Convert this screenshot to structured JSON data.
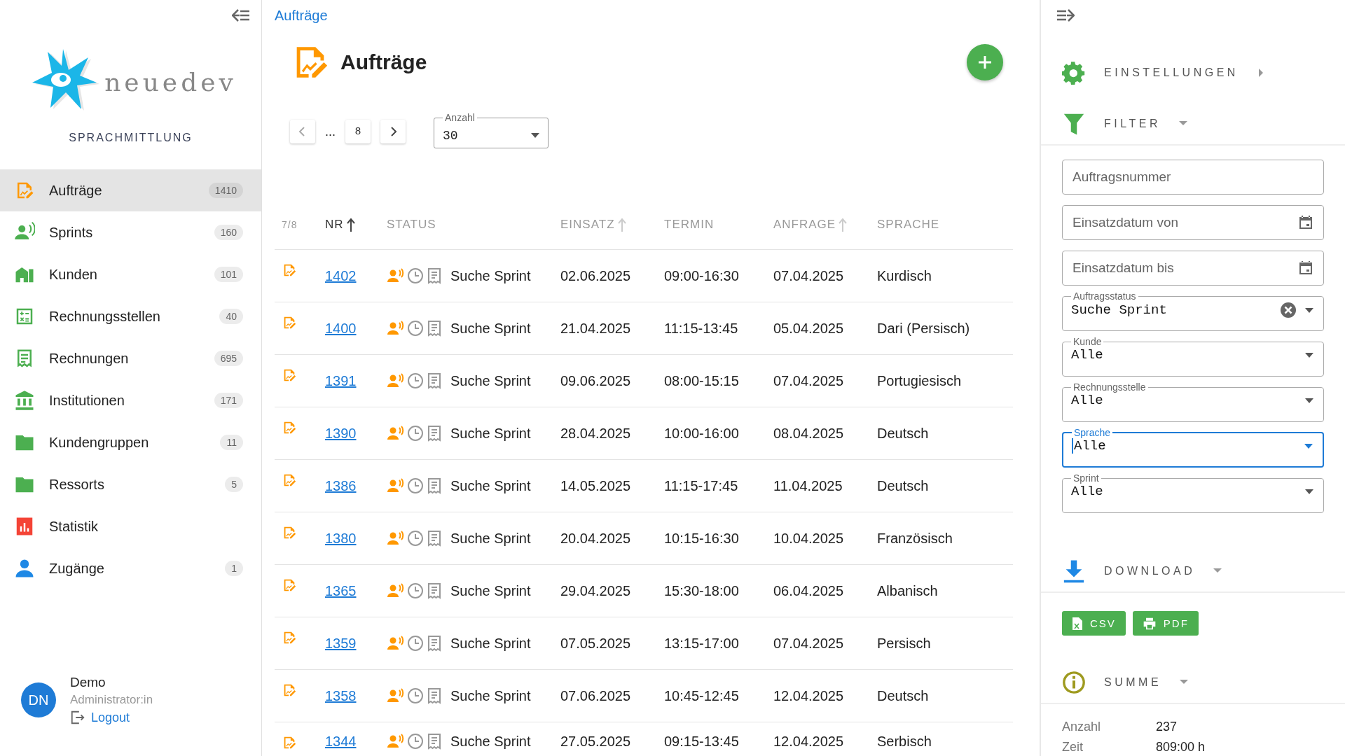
{
  "sidebar": {
    "brand": "neuedev",
    "subtitle": "SPRACHMITTLUNG",
    "items": [
      {
        "kind": "orders",
        "label": "Aufträge",
        "count": "1410",
        "color": "#ff9800",
        "selected": true
      },
      {
        "kind": "sprints",
        "label": "Sprints",
        "count": "160",
        "color": "#4caf50",
        "selected": false
      },
      {
        "kind": "customers",
        "label": "Kunden",
        "count": "101",
        "color": "#4caf50",
        "selected": false
      },
      {
        "kind": "billing",
        "label": "Rechnungsstellen",
        "count": "40",
        "color": "#4caf50",
        "selected": false
      },
      {
        "kind": "invoices",
        "label": "Rechnungen",
        "count": "695",
        "color": "#4caf50",
        "selected": false
      },
      {
        "kind": "institutions",
        "label": "Institutionen",
        "count": "171",
        "color": "#4caf50",
        "selected": false
      },
      {
        "kind": "groups",
        "label": "Kundengruppen",
        "count": "11",
        "color": "#4caf50",
        "selected": false
      },
      {
        "kind": "groups",
        "label": "Ressorts",
        "count": "5",
        "color": "#4caf50",
        "selected": false
      },
      {
        "kind": "stats",
        "label": "Statistik",
        "color": "#f44336",
        "selected": false
      },
      {
        "kind": "user",
        "label": "Zugänge",
        "count": "1",
        "color": "#1e88e5",
        "selected": false
      }
    ],
    "user": {
      "initials": "DN",
      "name": "Demo",
      "role": "Administrator:in",
      "logout": "Logout"
    }
  },
  "main": {
    "breadcrumb": "Aufträge",
    "title": "Aufträge",
    "pagination": {
      "ellipsis": "...",
      "page": "8"
    },
    "page_size": {
      "label": "Anzahl",
      "value": "30"
    },
    "table": {
      "columns": [
        {
          "label": "7/8"
        },
        {
          "label": "NR",
          "sorted": true
        },
        {
          "label": "STATUS"
        },
        {
          "label": "EINSATZ",
          "sorted": false
        },
        {
          "label": "TERMIN"
        },
        {
          "label": "ANFRAGE",
          "sorted": false
        },
        {
          "label": "SPRACHE"
        }
      ],
      "rows": [
        {
          "nr": "1402",
          "status": "Suche Sprint",
          "einsatz": "02.06.2025",
          "termin": "09:00-16:30",
          "anfrage": "07.04.2025",
          "sprache": "Kurdisch"
        },
        {
          "nr": "1400",
          "status": "Suche Sprint",
          "einsatz": "21.04.2025",
          "termin": "11:15-13:45",
          "anfrage": "05.04.2025",
          "sprache": "Dari (Persisch)"
        },
        {
          "nr": "1391",
          "status": "Suche Sprint",
          "einsatz": "09.06.2025",
          "termin": "08:00-15:15",
          "anfrage": "07.04.2025",
          "sprache": "Portugiesisch"
        },
        {
          "nr": "1390",
          "status": "Suche Sprint",
          "einsatz": "28.04.2025",
          "termin": "10:00-16:00",
          "anfrage": "08.04.2025",
          "sprache": "Deutsch"
        },
        {
          "nr": "1386",
          "status": "Suche Sprint",
          "einsatz": "14.05.2025",
          "termin": "11:15-17:45",
          "anfrage": "11.04.2025",
          "sprache": "Deutsch"
        },
        {
          "nr": "1380",
          "status": "Suche Sprint",
          "einsatz": "20.04.2025",
          "termin": "10:15-16:30",
          "anfrage": "10.04.2025",
          "sprache": "Französisch"
        },
        {
          "nr": "1365",
          "status": "Suche Sprint",
          "einsatz": "29.04.2025",
          "termin": "15:30-18:00",
          "anfrage": "06.04.2025",
          "sprache": "Albanisch"
        },
        {
          "nr": "1359",
          "status": "Suche Sprint",
          "einsatz": "07.05.2025",
          "termin": "13:15-17:00",
          "anfrage": "07.04.2025",
          "sprache": "Persisch"
        },
        {
          "nr": "1358",
          "status": "Suche Sprint",
          "einsatz": "07.06.2025",
          "termin": "10:45-12:45",
          "anfrage": "12.04.2025",
          "sprache": "Deutsch"
        },
        {
          "nr": "1344",
          "status": "Suche Sprint",
          "einsatz": "27.05.2025",
          "termin": "09:15-13:45",
          "anfrage": "12.04.2025",
          "sprache": "Serbisch"
        }
      ]
    }
  },
  "panel": {
    "sections": [
      {
        "kind": "settings",
        "title": "EINSTELLUNGEN",
        "expanded": false
      },
      {
        "kind": "filter",
        "title": "FILTER",
        "expanded": true,
        "fields": [
          {
            "kind": "text",
            "placeholder": "Auftragsnummer",
            "clearable": false,
            "focused": false
          },
          {
            "kind": "date",
            "placeholder": "Einsatzdatum von",
            "clearable": false,
            "focused": false
          },
          {
            "kind": "date",
            "placeholder": "Einsatzdatum bis",
            "clearable": false,
            "focused": false
          },
          {
            "kind": "select",
            "label": "Auftragsstatus",
            "value": "Suche Sprint",
            "clearable": true,
            "focused": false
          },
          {
            "kind": "select",
            "label": "Kunde",
            "value": "Alle",
            "clearable": false,
            "focused": false
          },
          {
            "kind": "select",
            "label": "Rechnungsstelle",
            "value": "Alle",
            "clearable": false,
            "focused": false
          },
          {
            "kind": "select",
            "label": "Sprache",
            "value": "Alle",
            "clearable": false,
            "focused": true
          },
          {
            "kind": "select",
            "label": "Sprint",
            "value": "Alle",
            "clearable": false,
            "focused": false
          }
        ]
      },
      {
        "kind": "download",
        "title": "DOWNLOAD",
        "expanded": true,
        "buttons": [
          {
            "kind": "csv",
            "label": "CSV"
          },
          {
            "kind": "pdf",
            "label": "PDF"
          }
        ]
      },
      {
        "kind": "sum",
        "title": "SUMME",
        "expanded": true,
        "rows": [
          {
            "label": "Anzahl",
            "value": "237"
          },
          {
            "label": "Zeit",
            "value": "809:00 h"
          }
        ]
      }
    ]
  }
}
